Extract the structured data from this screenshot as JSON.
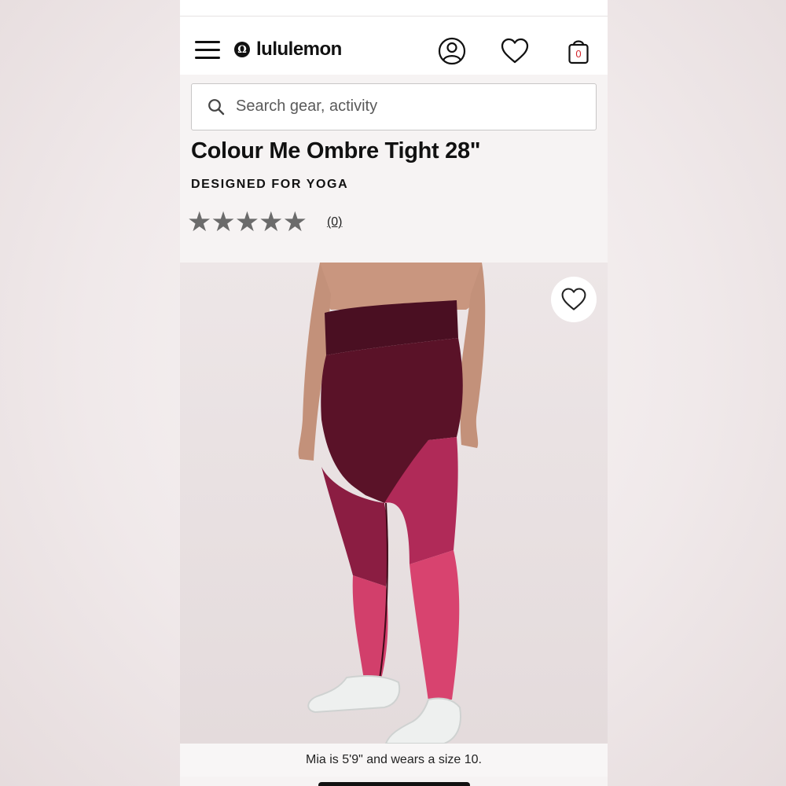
{
  "header": {
    "brand": "lululemon",
    "brand_mark": "Ω",
    "bag_count": "0",
    "icons": [
      "menu-icon",
      "account-icon",
      "heart-icon",
      "bag-icon"
    ]
  },
  "search": {
    "placeholder": "Search gear, activity"
  },
  "product": {
    "title": "Colour Me Ombre Tight 28\"",
    "designed_for": "DESIGNED FOR YOGA",
    "rating_stars": 5,
    "star_glyph": "★",
    "review_count": "(0)",
    "image_caption": "Mia is 5'9\" and wears a size 10."
  },
  "colors": {
    "star": "#6b6b6b",
    "tights_top": "#5a1228",
    "tights_mid": "#8b1d42",
    "tights_bottom": "#d23f6b"
  }
}
